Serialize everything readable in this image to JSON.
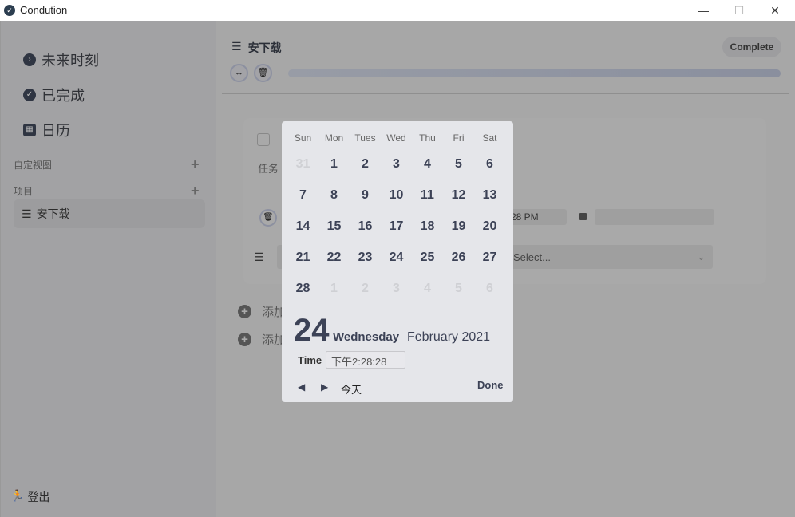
{
  "window": {
    "title": "Condution",
    "minimize": "—",
    "maximize": "☐",
    "close": "✕"
  },
  "sidebar": {
    "items": [
      {
        "label": "未来时刻",
        "icon": "chevron-right-circle-icon"
      },
      {
        "label": "已完成",
        "icon": "check-circle-icon"
      },
      {
        "label": "日历",
        "icon": "calendar-icon"
      }
    ],
    "custom_views": "自定视图",
    "projects": "项目",
    "add": "+",
    "project_items": [
      {
        "label": "安下载"
      }
    ],
    "logout": "登出"
  },
  "main": {
    "title": "安下载",
    "complete_label": "Complete",
    "progress": 0,
    "task": {
      "name_partial": "任务",
      "time_partial": "28 PM",
      "select_placeholder": "Select..."
    },
    "add_rows": [
      {
        "label": "添加"
      },
      {
        "label": "添加"
      }
    ]
  },
  "datepicker": {
    "weekdays": [
      "Sun",
      "Mon",
      "Tues",
      "Wed",
      "Thu",
      "Fri",
      "Sat"
    ],
    "weeks": [
      [
        "31",
        "1",
        "2",
        "3",
        "4",
        "5",
        "6"
      ],
      [
        "7",
        "8",
        "9",
        "10",
        "11",
        "12",
        "13"
      ],
      [
        "14",
        "15",
        "16",
        "17",
        "18",
        "19",
        "20"
      ],
      [
        "21",
        "22",
        "23",
        "24",
        "25",
        "26",
        "27"
      ],
      [
        "28",
        "1",
        "2",
        "3",
        "4",
        "5",
        "6"
      ]
    ],
    "selected_day": "24",
    "weekday": "Wednesday",
    "month_year": "February 2021",
    "time_label": "Time",
    "time_value": "下午2:28:28",
    "today_label": "今天",
    "done_label": "Done"
  },
  "colors": {
    "accent": "#3c4256",
    "overlay": "#a7a7a7",
    "popup": "#e5e6ea"
  }
}
